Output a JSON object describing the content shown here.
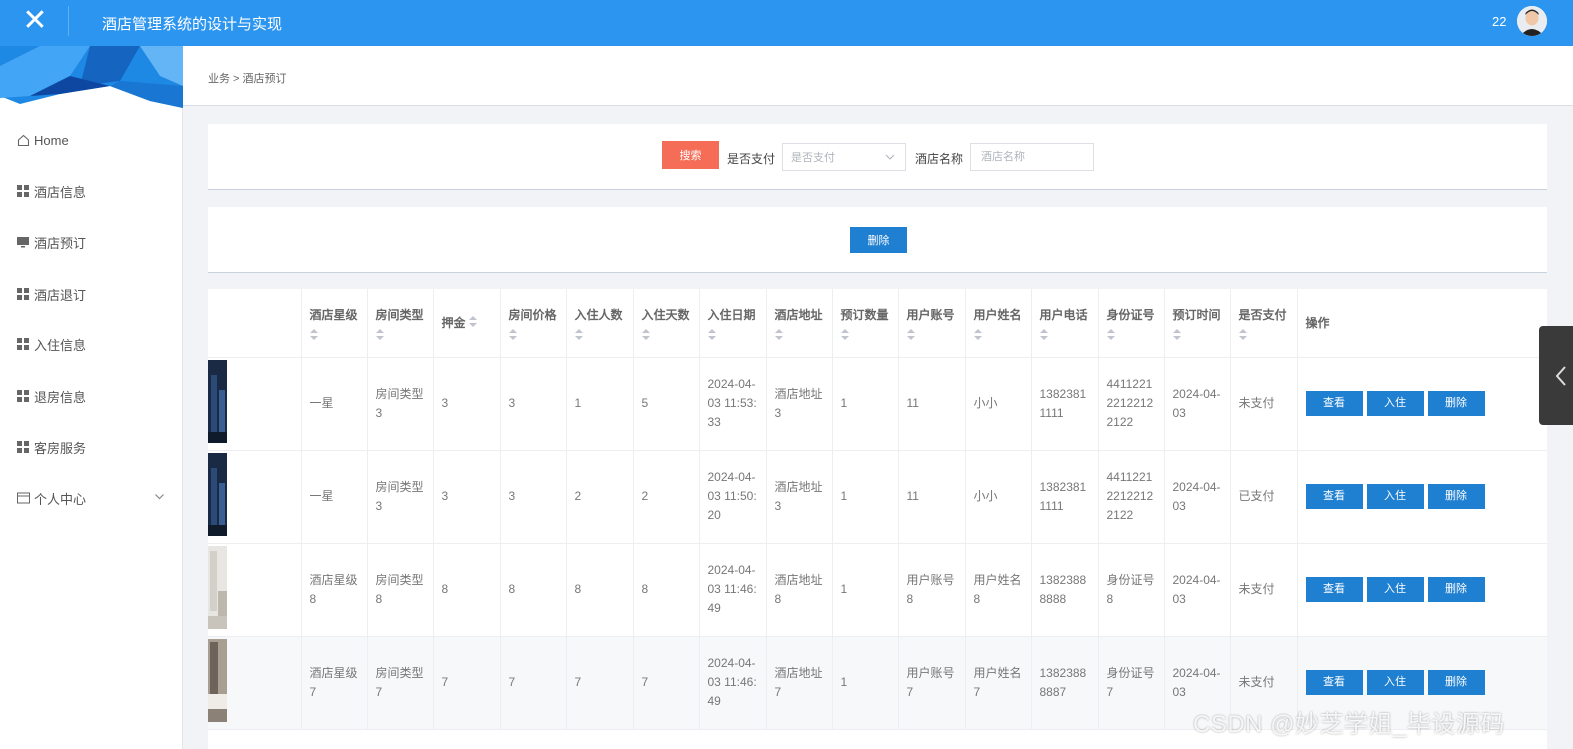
{
  "header": {
    "title": "酒店管理系统的设计与实现",
    "user_count": "22",
    "accent": "#2b95f0"
  },
  "sidebar": {
    "items": [
      {
        "label": "Home",
        "icon": "home-icon"
      },
      {
        "label": "酒店信息",
        "icon": "grid-icon"
      },
      {
        "label": "酒店预订",
        "icon": "monitor-icon"
      },
      {
        "label": "酒店退订",
        "icon": "grid-icon"
      },
      {
        "label": "入住信息",
        "icon": "grid-icon"
      },
      {
        "label": "退房信息",
        "icon": "grid-icon"
      },
      {
        "label": "客房服务",
        "icon": "grid-icon"
      },
      {
        "label": "个人中心",
        "icon": "card-icon"
      }
    ]
  },
  "breadcrumb": {
    "text": "业务 > 酒店预订"
  },
  "search": {
    "button": "搜索",
    "paid_label": "是否支付",
    "paid_placeholder": "是否支付",
    "hotel_label": "酒店名称",
    "hotel_placeholder": "酒店名称"
  },
  "actions": {
    "delete": "删除"
  },
  "table": {
    "headers": [
      "酒店星级",
      "房间类型",
      "押金",
      "房间价格",
      "入住人数",
      "入住天数",
      "入住日期",
      "酒店地址",
      "预订数量",
      "用户账号",
      "用户姓名",
      "用户电话",
      "身份证号",
      "预订时间",
      "是否支付",
      "操作"
    ],
    "rows": [
      {
        "star": "一星",
        "room_type": "房间类型3",
        "deposit": "3",
        "price": "3",
        "guests": "1",
        "days": "5",
        "checkin": "2024-04-03 11:53:33",
        "address": "酒店地址3",
        "qty": "1",
        "account": "11",
        "name": "小小",
        "phone": "13823811111",
        "id_no": "441122122122122122",
        "book_time": "2024-04-03",
        "paid": "未支付"
      },
      {
        "star": "一星",
        "room_type": "房间类型3",
        "deposit": "3",
        "price": "3",
        "guests": "2",
        "days": "2",
        "checkin": "2024-04-03 11:50:20",
        "address": "酒店地址3",
        "qty": "1",
        "account": "11",
        "name": "小小",
        "phone": "13823811111",
        "id_no": "441122122122122122",
        "book_time": "2024-04-03",
        "paid": "已支付"
      },
      {
        "star": "酒店星级8",
        "room_type": "房间类型8",
        "deposit": "8",
        "price": "8",
        "guests": "8",
        "days": "8",
        "checkin": "2024-04-03 11:46:49",
        "address": "酒店地址8",
        "qty": "1",
        "account": "用户账号8",
        "name": "用户姓名8",
        "phone": "13823888888",
        "id_no": "身份证号8",
        "book_time": "2024-04-03",
        "paid": "未支付"
      },
      {
        "star": "酒店星级7",
        "room_type": "房间类型7",
        "deposit": "7",
        "price": "7",
        "guests": "7",
        "days": "7",
        "checkin": "2024-04-03 11:46:49",
        "address": "酒店地址7",
        "qty": "1",
        "account": "用户账号7",
        "name": "用户姓名7",
        "phone": "13823888887",
        "id_no": "身份证号7",
        "book_time": "2024-04-03",
        "paid": "未支付"
      }
    ],
    "row_actions": {
      "view": "查看",
      "checkin": "入住",
      "delete": "删除"
    }
  },
  "watermark": "CSDN @妙芝学姐_毕设源码"
}
